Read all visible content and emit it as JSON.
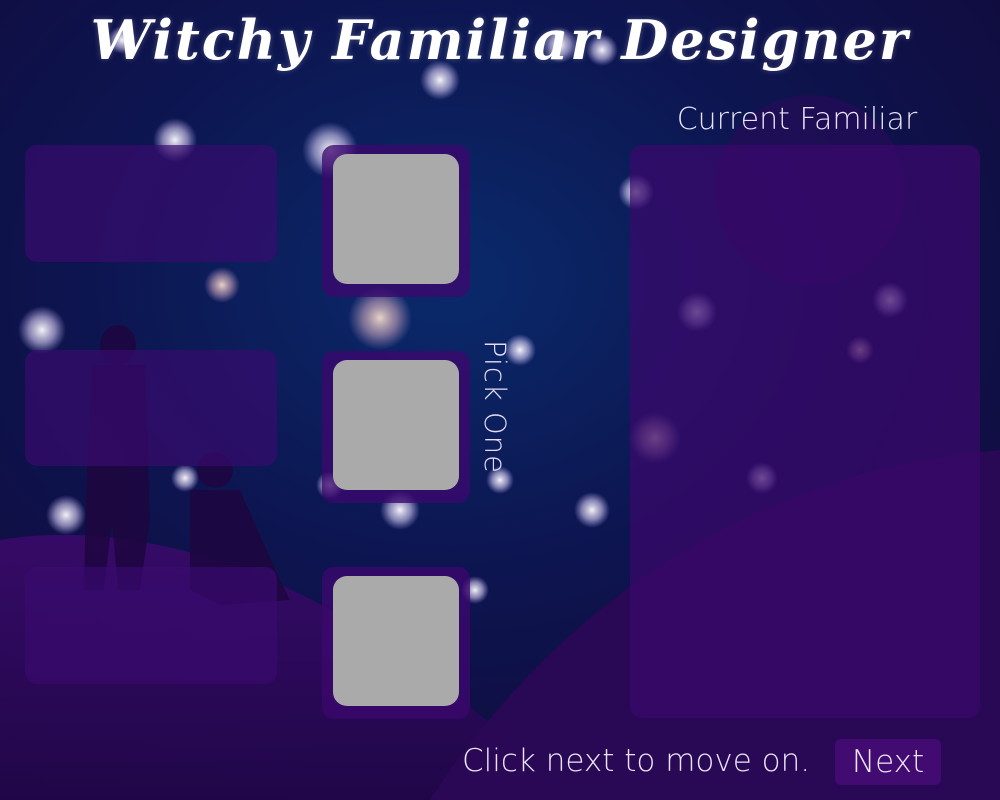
{
  "title": "Witchy  Familiar  Designer",
  "current_familiar_label": "Current Familiar",
  "pick_label": "Pick One",
  "hint_text": "Click next to move on.",
  "next_label": "Next",
  "colors": {
    "swatch_placeholder": "#aaaaaa",
    "panel": "#3a0a6e",
    "sky": "#0d0a3a"
  }
}
